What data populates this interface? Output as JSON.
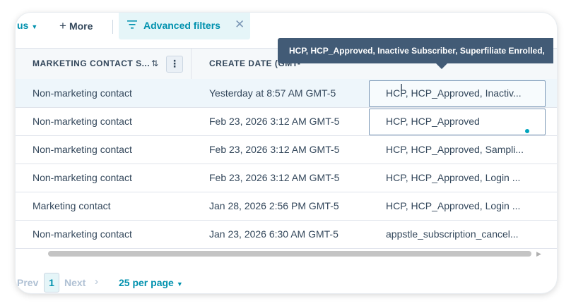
{
  "toolbar": {
    "status_filter_label": "us",
    "more_label": "More",
    "advanced_filters_label": "Advanced filters"
  },
  "table": {
    "headers": {
      "marketing_status": "MARKETING CONTACT S...",
      "create_date": "CREATE DATE (GMT-"
    },
    "rows": [
      {
        "status": "Non-marketing contact",
        "date": "Yesterday at 8:57 AM GMT-5",
        "tags": "HCP, HCP_Approved, Inactiv..."
      },
      {
        "status": "Non-marketing contact",
        "date": "Feb 23, 2026 3:12 AM GMT-5",
        "tags": "HCP, HCP_Approved"
      },
      {
        "status": "Non-marketing contact",
        "date": "Feb 23, 2026 3:12 AM GMT-5",
        "tags": "HCP, HCP_Approved, Sampli..."
      },
      {
        "status": "Non-marketing contact",
        "date": "Feb 23, 2026 3:12 AM GMT-5",
        "tags": "HCP, HCP_Approved, Login ..."
      },
      {
        "status": "Marketing contact",
        "date": "Jan 28, 2026 2:56 PM GMT-5",
        "tags": "HCP, HCP_Approved, Login ..."
      },
      {
        "status": "Non-marketing contact",
        "date": "Jan 23, 2026 6:30 AM GMT-5",
        "tags": "appstle_subscription_cancel..."
      }
    ]
  },
  "tooltip": {
    "text": "HCP, HCP_Approved, Inactive Subscriber, Superfiliate Enrolled,"
  },
  "pagination": {
    "prev_label": "Prev",
    "current_page": "1",
    "next_label": "Next",
    "per_page_label": "25 per page"
  },
  "colors": {
    "accent": "#0091ae",
    "text": "#33475b",
    "tooltip_bg": "#425b76",
    "header_bg": "#f5f8fa",
    "highlight_row": "#eef6fb"
  }
}
